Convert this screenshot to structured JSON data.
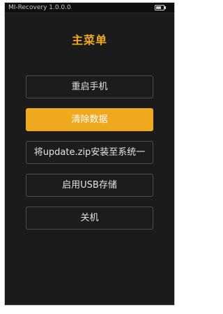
{
  "status_bar": {
    "title": "MI-Recovery 1.0.0.0",
    "battery_icon": "battery-icon"
  },
  "menu": {
    "title": "主菜单",
    "accent_color": "#f0a81e",
    "selected_index": 1,
    "items": [
      {
        "label": "重启手机"
      },
      {
        "label": "清除数据"
      },
      {
        "label": "将update.zip安装至系统一"
      },
      {
        "label": "启用USB存储"
      },
      {
        "label": "关机"
      }
    ]
  }
}
